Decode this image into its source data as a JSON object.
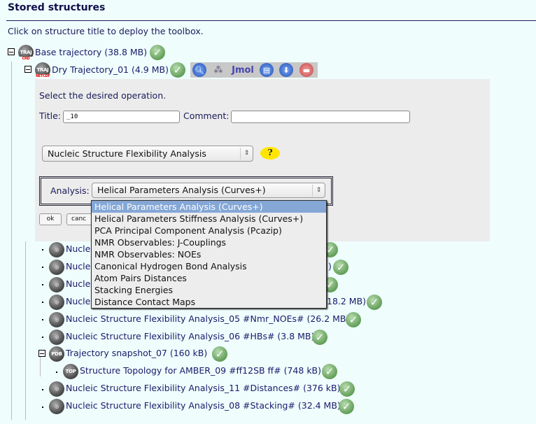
{
  "header": {
    "title": "Stored structures",
    "hint": "Click on structure title to deploy the toolbox."
  },
  "tree": {
    "base": {
      "label": "Base trajectory (38.8 MB)",
      "icon": "TRAJ",
      "sub": "CRD"
    },
    "dry": {
      "label": "Dry Trajectory_01 (4.9 MB)",
      "icon": "TRAJ",
      "sub": "NETCDF"
    },
    "toolbar": [
      "search-icon",
      "molecule-icon",
      "jmol-icon",
      "document-icon",
      "download-icon",
      "trash-icon"
    ],
    "hidden_rows": [
      {
        "label": "Nucle",
        "suffix": ""
      },
      {
        "label": "Nucle",
        "suffix": ")"
      },
      {
        "label": "Nucle",
        "suffix": ""
      },
      {
        "label": "Nucle",
        "suffix": "18.2 MB)"
      }
    ],
    "rows": [
      {
        "label": "Nucleic Structure Flexibility Analysis_05 #Nmr_NOEs# (26.2 MB)"
      },
      {
        "label": "Nucleic Structure Flexibility Analysis_06 #HBs# (3.8 MB)"
      }
    ],
    "snapshot": {
      "label": "Trajectory snapshot_07 (160 kB)",
      "icon": "PDB"
    },
    "topology": {
      "label": "Structure Topology for AMBER_09 #ff12SB ff# (748 kB)",
      "icon": "TOP"
    },
    "rows2": [
      {
        "label": "Nucleic Structure Flexibility Analysis_11 #Distances# (376 kB)"
      },
      {
        "label": "Nucleic Structure Flexibility Analysis_08 #Stacking# (32.4 MB)"
      }
    ]
  },
  "panel": {
    "prompt": "Select the desired operation.",
    "title_label": "Title:",
    "title_value": "_10",
    "comment_label": "Comment:",
    "comment_value": "",
    "operation": "Nucleic Structure Flexibility Analysis",
    "help": "?",
    "analysis_label": "Analysis:",
    "analysis_value": "Helical Parameters Analysis (Curves+)",
    "ok": "ok",
    "cancel": "canc"
  },
  "dropdown": {
    "options": [
      "Helical Parameters Analysis (Curves+)",
      "Helical Parameters Stiffness Analysis (Curves+)",
      "PCA Principal Component Analysis (Pcazip)",
      "NMR Observables: J-Couplings",
      "NMR Observables: NOEs",
      "Canonical Hydrogen Bond Analysis",
      "Atom Pairs Distances",
      "Stacking Energies",
      "Distance Contact Maps"
    ],
    "selected": 0
  },
  "colors": {
    "background": "#effdfd",
    "panel": "#ececec",
    "selected_option": "#84a7d6",
    "link": "#1a1a6a"
  }
}
